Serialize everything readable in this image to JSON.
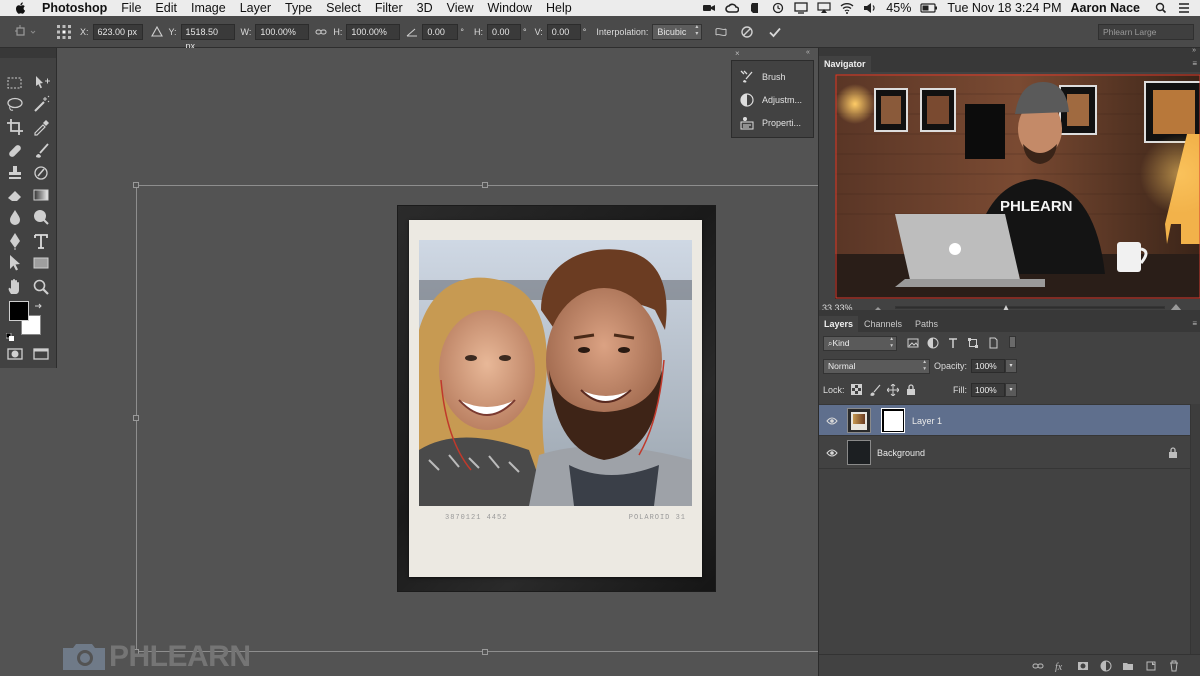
{
  "menubar": {
    "app_name": "Photoshop",
    "items": [
      "File",
      "Edit",
      "Image",
      "Layer",
      "Type",
      "Select",
      "Filter",
      "3D",
      "View",
      "Window",
      "Help"
    ],
    "battery": "45%",
    "datetime": "Tue Nov 18  3:24 PM",
    "user": "Aaron Nace"
  },
  "options": {
    "x_label": "X:",
    "x_value": "623.00 px",
    "y_label": "Y:",
    "y_value": "1518.50 px",
    "w_label": "W:",
    "w_value": "100.00%",
    "h_label": "H:",
    "h_value": "100.00%",
    "angle_value": "0.00",
    "hskew_label": "H:",
    "hskew_value": "0.00",
    "vskew_label": "V:",
    "vskew_value": "0.00",
    "degree_symbol": "°",
    "interp_label": "Interpolation:",
    "interp_value": "Bicubic",
    "workspace": "Phlearn Large"
  },
  "mini_panel": {
    "items": [
      "Brush",
      "Adjustm...",
      "Properti..."
    ]
  },
  "navigator": {
    "tab": "Navigator",
    "zoom": "33.33%",
    "shirt_text": "PHLEARN",
    "sign_letter": "A"
  },
  "layers_panel": {
    "tabs": [
      "Layers",
      "Channels",
      "Paths"
    ],
    "filter_kind": "Kind",
    "blend_mode": "Normal",
    "opacity_label": "Opacity:",
    "opacity_value": "100%",
    "lock_label": "Lock:",
    "fill_label": "Fill:",
    "fill_value": "100%",
    "layers": [
      {
        "name": "Layer 1",
        "selected": true
      },
      {
        "name": "Background",
        "locked": true
      }
    ]
  },
  "document": {
    "caption_left": "3870121 4452",
    "caption_right": "POLAROID 31"
  },
  "watermark": "PHLEARN",
  "colors": {
    "selection": "#5f6f8d",
    "panel": "#424242",
    "canvas": "#535353"
  }
}
